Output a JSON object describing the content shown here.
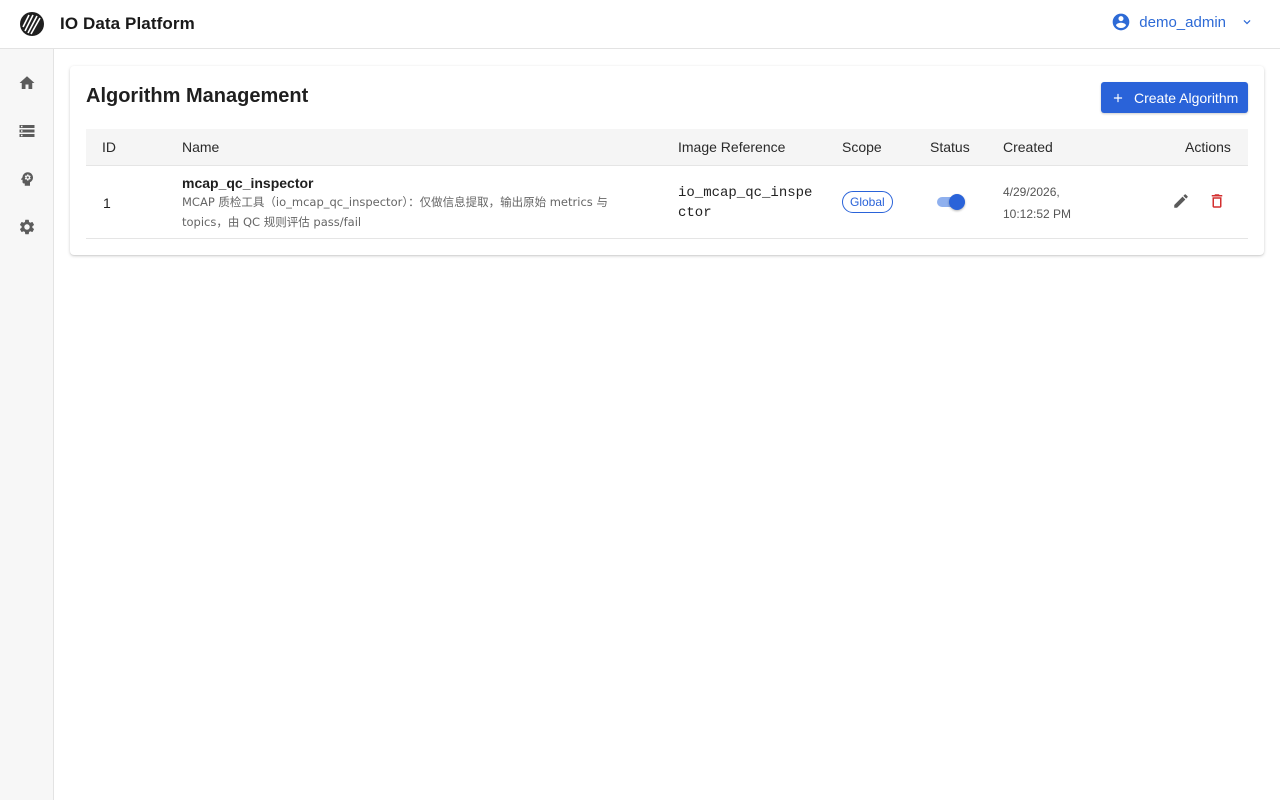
{
  "app": {
    "title": "IO Data Platform",
    "logo_icon": "platform-logo-icon"
  },
  "user": {
    "name": "demo_admin",
    "icon": "account-circle-icon",
    "menu_icon": "chevron-down-icon"
  },
  "sidebar": {
    "items": [
      {
        "name": "home",
        "icon": "home-icon"
      },
      {
        "name": "data",
        "icon": "list-storage-icon"
      },
      {
        "name": "algorithms",
        "icon": "brain-head-icon"
      },
      {
        "name": "settings",
        "icon": "gear-icon"
      }
    ]
  },
  "page": {
    "title": "Algorithm Management",
    "create_button_label": "Create Algorithm"
  },
  "table": {
    "headers": {
      "id": "ID",
      "name": "Name",
      "image": "Image Reference",
      "scope": "Scope",
      "status": "Status",
      "created": "Created",
      "actions": "Actions"
    },
    "rows": [
      {
        "id": "1",
        "name": "mcap_qc_inspector",
        "description": "MCAP 质检工具（io_mcap_qc_inspector）：仅做信息提取，输出原始 metrics 与 topics，由 QC 规则评估 pass/fail",
        "image_reference": "io_mcap_qc_inspector",
        "scope": "Global",
        "enabled": true,
        "created_date": "4/29/2026,",
        "created_time": "10:12:52 PM"
      }
    ]
  },
  "colors": {
    "primary": "#2a63d9",
    "danger": "#d32f2f",
    "sidebar_bg": "#f7f7f7",
    "header_row_bg": "#f5f5f5"
  }
}
